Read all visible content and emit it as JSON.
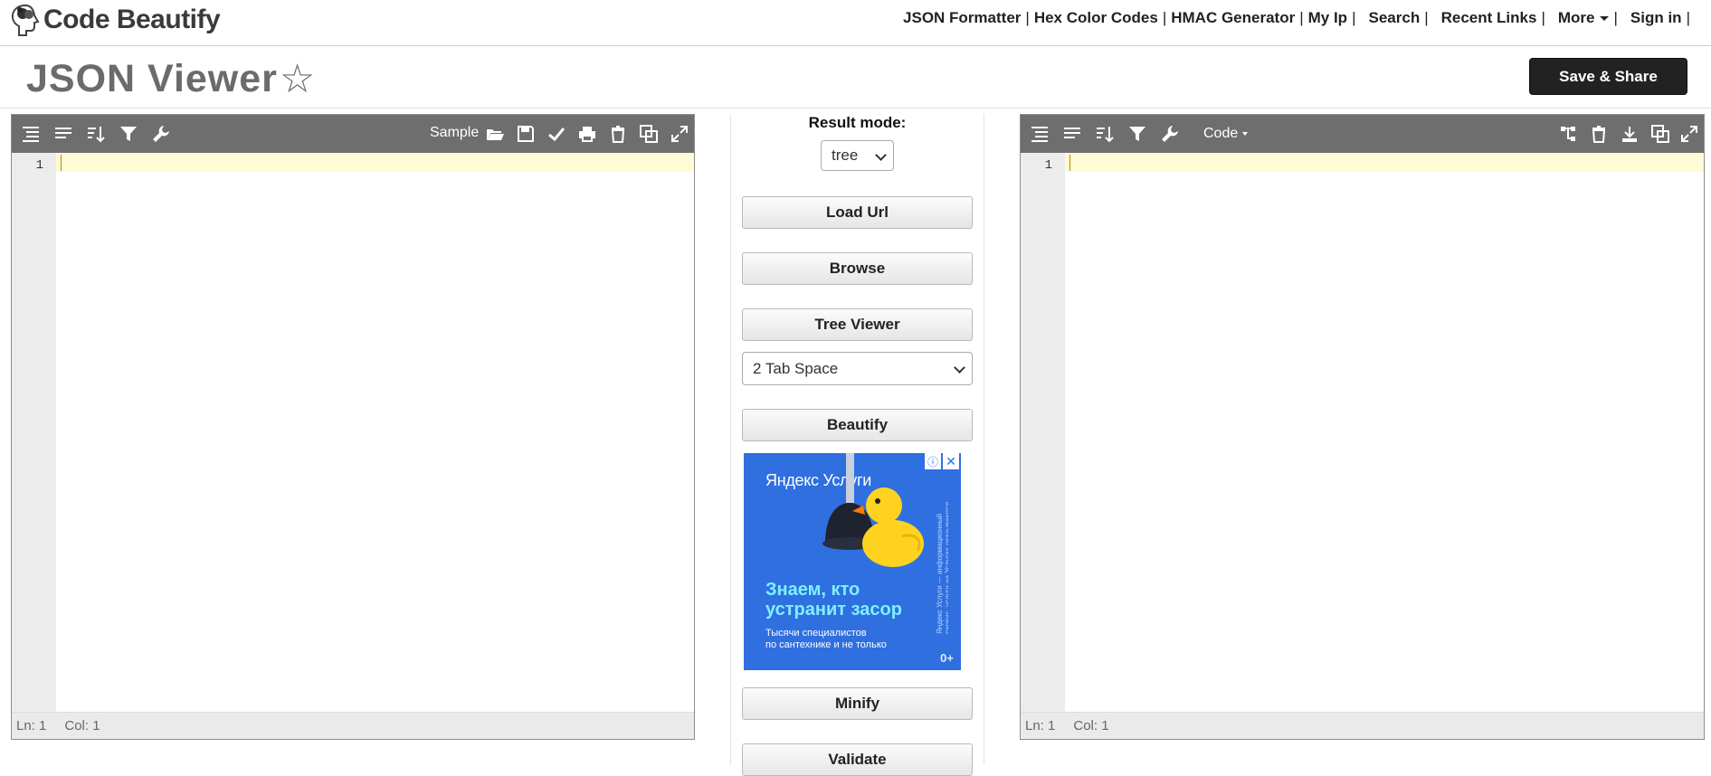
{
  "header": {
    "logo_text": "Code Beautify",
    "nav": [
      {
        "label": "JSON Formatter"
      },
      {
        "label": "Hex Color Codes"
      },
      {
        "label": "HMAC Generator"
      },
      {
        "label": "My Ip"
      },
      {
        "label": "Search"
      },
      {
        "label": "Recent Links"
      },
      {
        "label": "More"
      },
      {
        "label": "Sign in"
      }
    ],
    "separator": "|"
  },
  "page": {
    "title": "JSON Viewer",
    "favorite_glyph": "☆",
    "save_share_label": "Save & Share"
  },
  "left_editor": {
    "sample_label": "Sample",
    "line_number": "1",
    "status_ln": "Ln: 1",
    "status_col": "Col: 1"
  },
  "right_editor": {
    "mode_label": "Code",
    "line_number": "1",
    "status_ln": "Ln: 1",
    "status_col": "Col: 1"
  },
  "middle": {
    "result_mode_label": "Result mode:",
    "result_mode_value": "tree",
    "load_url_label": "Load Url",
    "browse_label": "Browse",
    "tree_viewer_label": "Tree Viewer",
    "tab_space_value": "2 Tab Space",
    "beautify_label": "Beautify",
    "minify_label": "Minify",
    "validate_label": "Validate"
  },
  "ad": {
    "brand": "Яндекс Услуги",
    "headline_line1": "Знаем, кто",
    "headline_line2": "устранит засор",
    "sub_line1": "Тысячи специалистов",
    "sub_line2": "по сантехнике и не только",
    "age": "0+",
    "side_text": "Яндекс Услуги — информационный сервис, услуги на Услугах оказываются исполнителями."
  },
  "colors": {
    "toolbar_bg": "#6e6e6e",
    "active_line": "#fffbd6",
    "save_share_bg": "#222222",
    "ad_bg": "#2f6fe0"
  }
}
